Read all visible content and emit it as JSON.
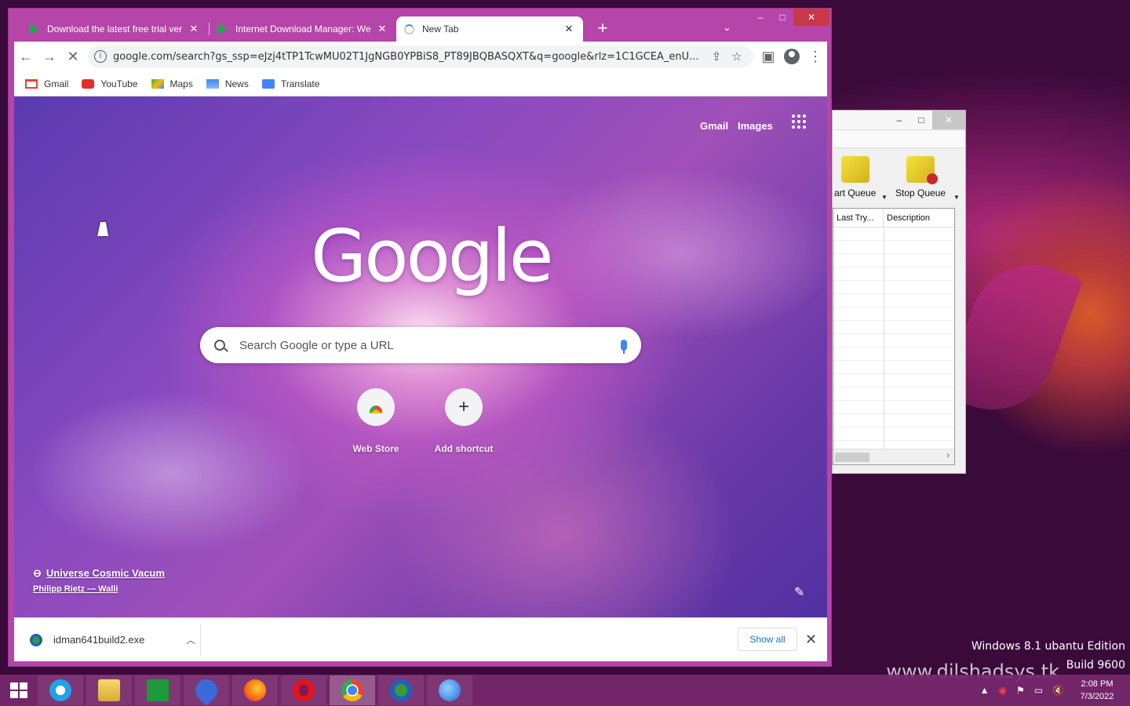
{
  "browser": {
    "tabs": [
      {
        "title": "Download the latest free trial ver",
        "active": false
      },
      {
        "title": "Internet Download Manager: We",
        "active": false
      },
      {
        "title": "New Tab",
        "active": true
      }
    ],
    "url": "google.com/search?gs_ssp=eJzj4tTP1TcwMU02T1JgNGB0YPBiS8_PT89JBQBASQXT&q=google&rlz=1C1GCEA_enU...",
    "bookmarks": [
      "Gmail",
      "YouTube",
      "Maps",
      "News",
      "Translate"
    ],
    "window_controls": {
      "min": "–",
      "max": "□",
      "close": "✕"
    }
  },
  "ntp": {
    "top_links": {
      "gmail": "Gmail",
      "images": "Images"
    },
    "logo": "Google",
    "search_placeholder": "Search Google or type a URL",
    "shortcuts": [
      {
        "label": "Web Store",
        "icon": "chrome-webstore-icon"
      },
      {
        "label": "Add shortcut",
        "icon": "plus-icon"
      }
    ],
    "background_credit": {
      "title": "Universe Cosmic Vacum",
      "author": "Philipp Rietz — Walli"
    }
  },
  "downloads": {
    "file": "idman641build2.exe",
    "show_all": "Show all"
  },
  "idm": {
    "buttons": [
      "art Queue",
      "Stop Queue"
    ],
    "columns": [
      "Last Try...",
      "Description"
    ]
  },
  "desktop": {
    "watermark_line1": "Windows 8.1 ubantu Edition",
    "watermark_line2": "Build 9600",
    "site": "www.dilshadsys.tk"
  },
  "taskbar": {
    "apps": [
      "internet-explorer",
      "file-explorer",
      "store",
      "drop-app",
      "firefox",
      "opera",
      "chrome",
      "idm",
      "thunderbird"
    ],
    "time": "2:08 PM",
    "date": "7/3/2022"
  }
}
